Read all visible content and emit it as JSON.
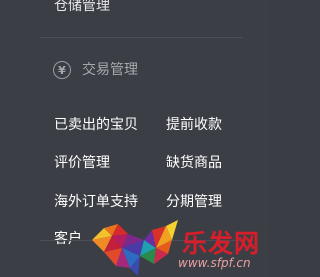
{
  "menu": {
    "top_item": "仓储管理",
    "section": {
      "icon": "yen-icon",
      "icon_glyph": "¥",
      "title": "交易管理"
    },
    "links": [
      {
        "label": "已卖出的宝贝"
      },
      {
        "label": "提前收款"
      },
      {
        "label": "评价管理"
      },
      {
        "label": "缺货商品"
      },
      {
        "label": "海外订单支持"
      },
      {
        "label": "分期管理"
      },
      {
        "label": "客户"
      }
    ]
  },
  "watermark": {
    "text": "乐发网",
    "url": "www.sfpf.cn",
    "color": "#d81e2a"
  }
}
